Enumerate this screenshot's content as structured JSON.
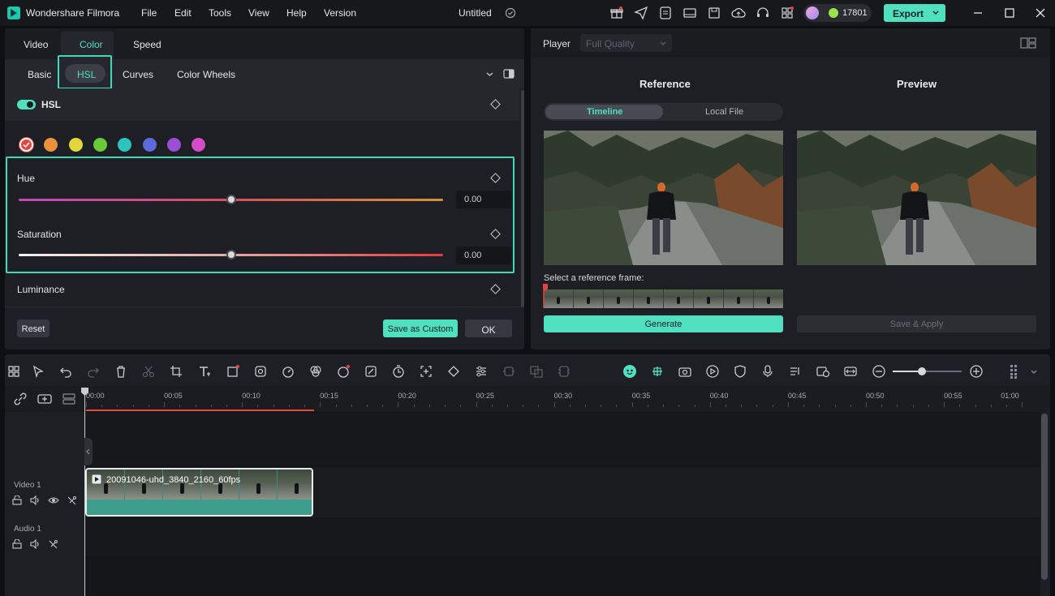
{
  "app": {
    "name": "Wondershare Filmora",
    "project_title": "Untitled",
    "credits": "17801",
    "export_label": "Export"
  },
  "menu": [
    "File",
    "Edit",
    "Tools",
    "View",
    "Help",
    "Version"
  ],
  "left_panel": {
    "top_tabs": [
      "Video",
      "Color",
      "Speed"
    ],
    "active_top_tab": "Color",
    "sub_tabs": [
      "Basic",
      "HSL",
      "Curves",
      "Color Wheels"
    ],
    "active_sub_tab": "HSL",
    "hsl_toggle_label": "HSL",
    "hsl_enabled": true,
    "swatches": [
      "#e8443f",
      "#e8923d",
      "#e3d63c",
      "#69c93a",
      "#2ec4be",
      "#5b6bdb",
      "#9a4fd6",
      "#d64bc8"
    ],
    "hue": {
      "label": "Hue",
      "value": "0.00",
      "position": 0.5
    },
    "saturation": {
      "label": "Saturation",
      "value": "0.00",
      "position": 0.5
    },
    "luminance": {
      "label": "Luminance"
    },
    "reset_label": "Reset",
    "save_custom_label": "Save as Custom",
    "ok_label": "OK"
  },
  "player": {
    "label": "Player",
    "quality": "Full Quality",
    "reference_title": "Reference",
    "preview_title": "Preview",
    "ref_tabs": [
      "Timeline",
      "Local File"
    ],
    "active_ref_tab": "Timeline",
    "select_frame_label": "Select a reference frame:",
    "generate_label": "Generate",
    "save_apply_label": "Save & Apply"
  },
  "timeline": {
    "ruler": [
      "00:00",
      "00:05",
      "00:10",
      "00:15",
      "00:20",
      "00:25",
      "00:30",
      "00:35",
      "00:40",
      "00:45",
      "00:50",
      "00:55",
      "01:00"
    ],
    "video_track_label": "Video 1",
    "audio_track_label": "Audio 1",
    "clip_name": "20091046-uhd_3840_2160_60fps"
  },
  "colors": {
    "accent": "#4fe0c0",
    "highlight_border": "#3fd9b4"
  }
}
